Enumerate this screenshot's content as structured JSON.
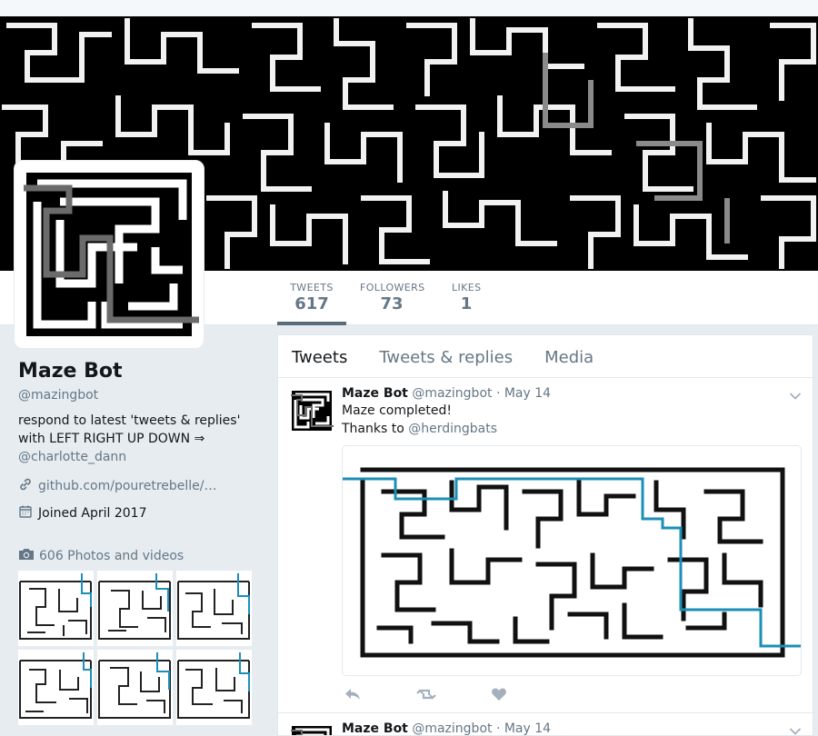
{
  "profile": {
    "name": "Maze Bot",
    "handle": "@mazingbot",
    "bio": "respond to latest 'tweets & replies' with LEFT RIGHT UP DOWN ⇒",
    "bio_mention": "@charlotte_dann",
    "website": "github.com/pouretrebelle/…",
    "joined": "Joined April 2017",
    "photos_label": "606 Photos and videos"
  },
  "stats": [
    {
      "label": "TWEETS",
      "value": "617"
    },
    {
      "label": "FOLLOWERS",
      "value": "73"
    },
    {
      "label": "LIKES",
      "value": "1"
    }
  ],
  "tabs": [
    "Tweets",
    "Tweets & replies",
    "Media"
  ],
  "tweets": [
    {
      "name": "Maze Bot",
      "handle": "@mazingbot",
      "date": "· May 14",
      "line1": "Maze completed!",
      "line2_prefix": "Thanks to ",
      "line2_mention": "@herdingbats"
    },
    {
      "name": "Maze Bot",
      "handle": "@mazingbot",
      "date": "· May 14"
    }
  ],
  "icons": {
    "website": "link-icon",
    "joined": "calendar-icon",
    "photos": "camera-icon",
    "reply": "reply-icon",
    "retweet": "retweet-icon",
    "like": "heart-icon",
    "menu": "chevron-down-icon"
  },
  "colors": {
    "accent_path": "#1b8fb8",
    "muted": "#657786",
    "background": "#e6ecf0"
  }
}
